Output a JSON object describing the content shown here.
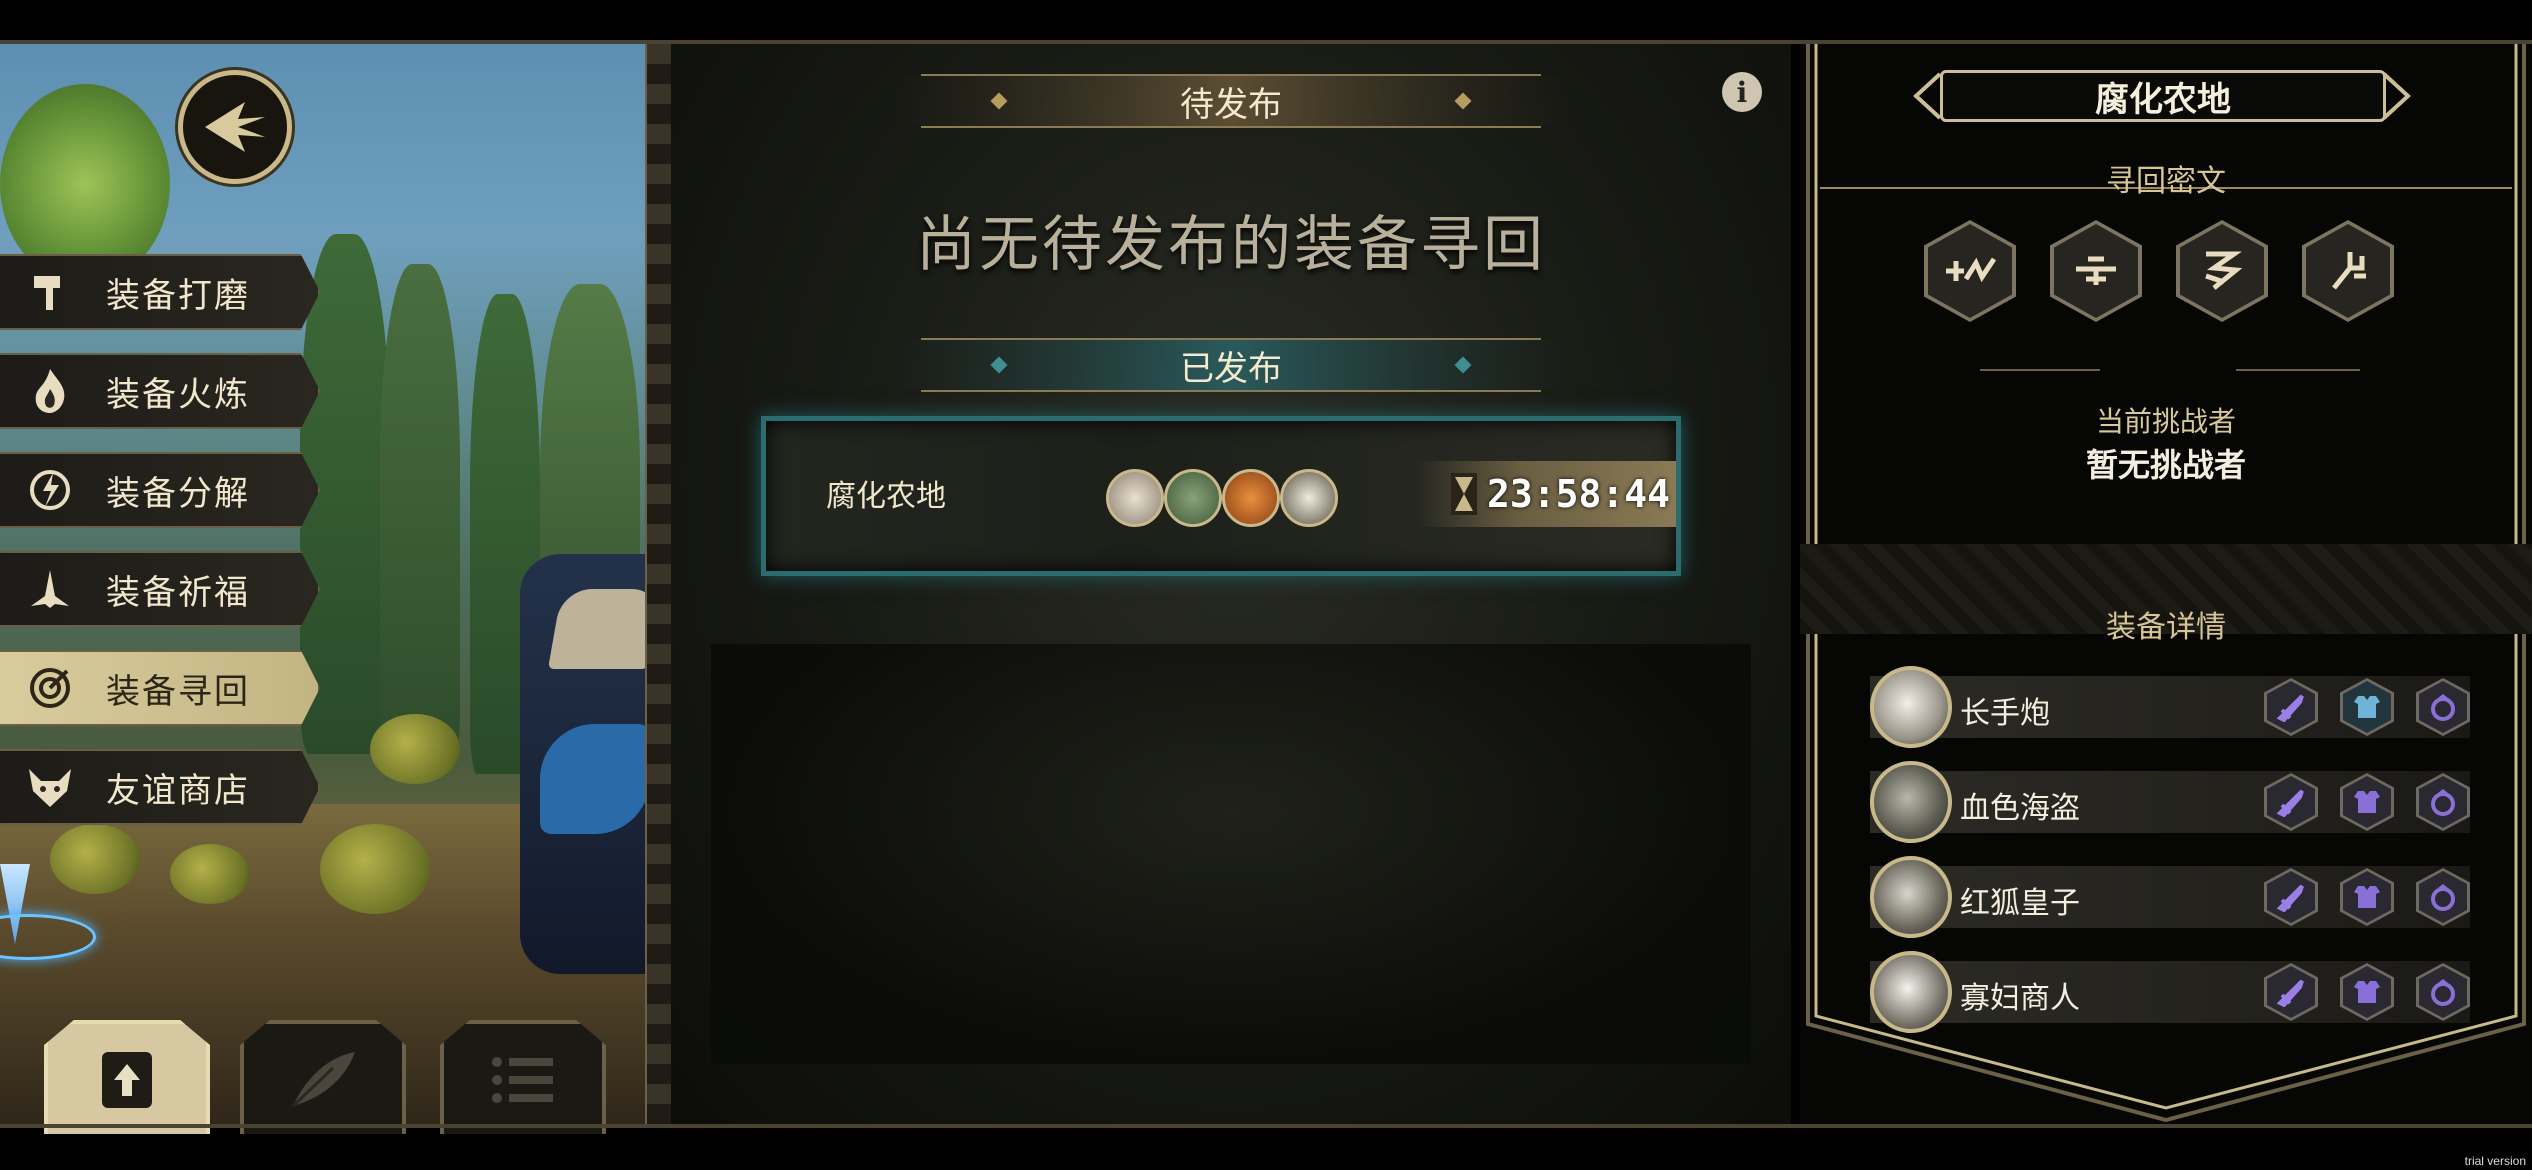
{
  "menu": {
    "items": [
      {
        "label": "装备打磨",
        "icon": "hammer-icon"
      },
      {
        "label": "装备火炼",
        "icon": "flame-icon"
      },
      {
        "label": "装备分解",
        "icon": "dismantle-icon"
      },
      {
        "label": "装备祈福",
        "icon": "pray-icon"
      },
      {
        "label": "装备寻回",
        "icon": "target-icon",
        "active": true
      },
      {
        "label": "友谊商店",
        "icon": "fox-icon"
      }
    ]
  },
  "bottom_tabs": [
    {
      "icon": "publish-icon",
      "active": true
    },
    {
      "icon": "feather-icon"
    },
    {
      "icon": "list-icon"
    }
  ],
  "center": {
    "pending_header": "待发布",
    "empty_message": "尚无待发布的装备寻回",
    "published_header": "已发布",
    "mission": {
      "name": "腐化农地",
      "timer": "23:58:44"
    }
  },
  "right_panel": {
    "title": "腐化农地",
    "secret_header": "寻回密文",
    "challenger_label": "当前挑战者",
    "challenger_value": "暂无挑战者",
    "detail_header": "装备详情",
    "equipment": [
      {
        "name": "长手炮"
      },
      {
        "name": "血色海盗"
      },
      {
        "name": "红狐皇子"
      },
      {
        "name": "寡妇商人"
      }
    ]
  },
  "colors": {
    "gold": "#cbbf98",
    "teal": "#2c6b6f",
    "equip_purple": "#8a6fd6"
  },
  "watermark": "trial version"
}
